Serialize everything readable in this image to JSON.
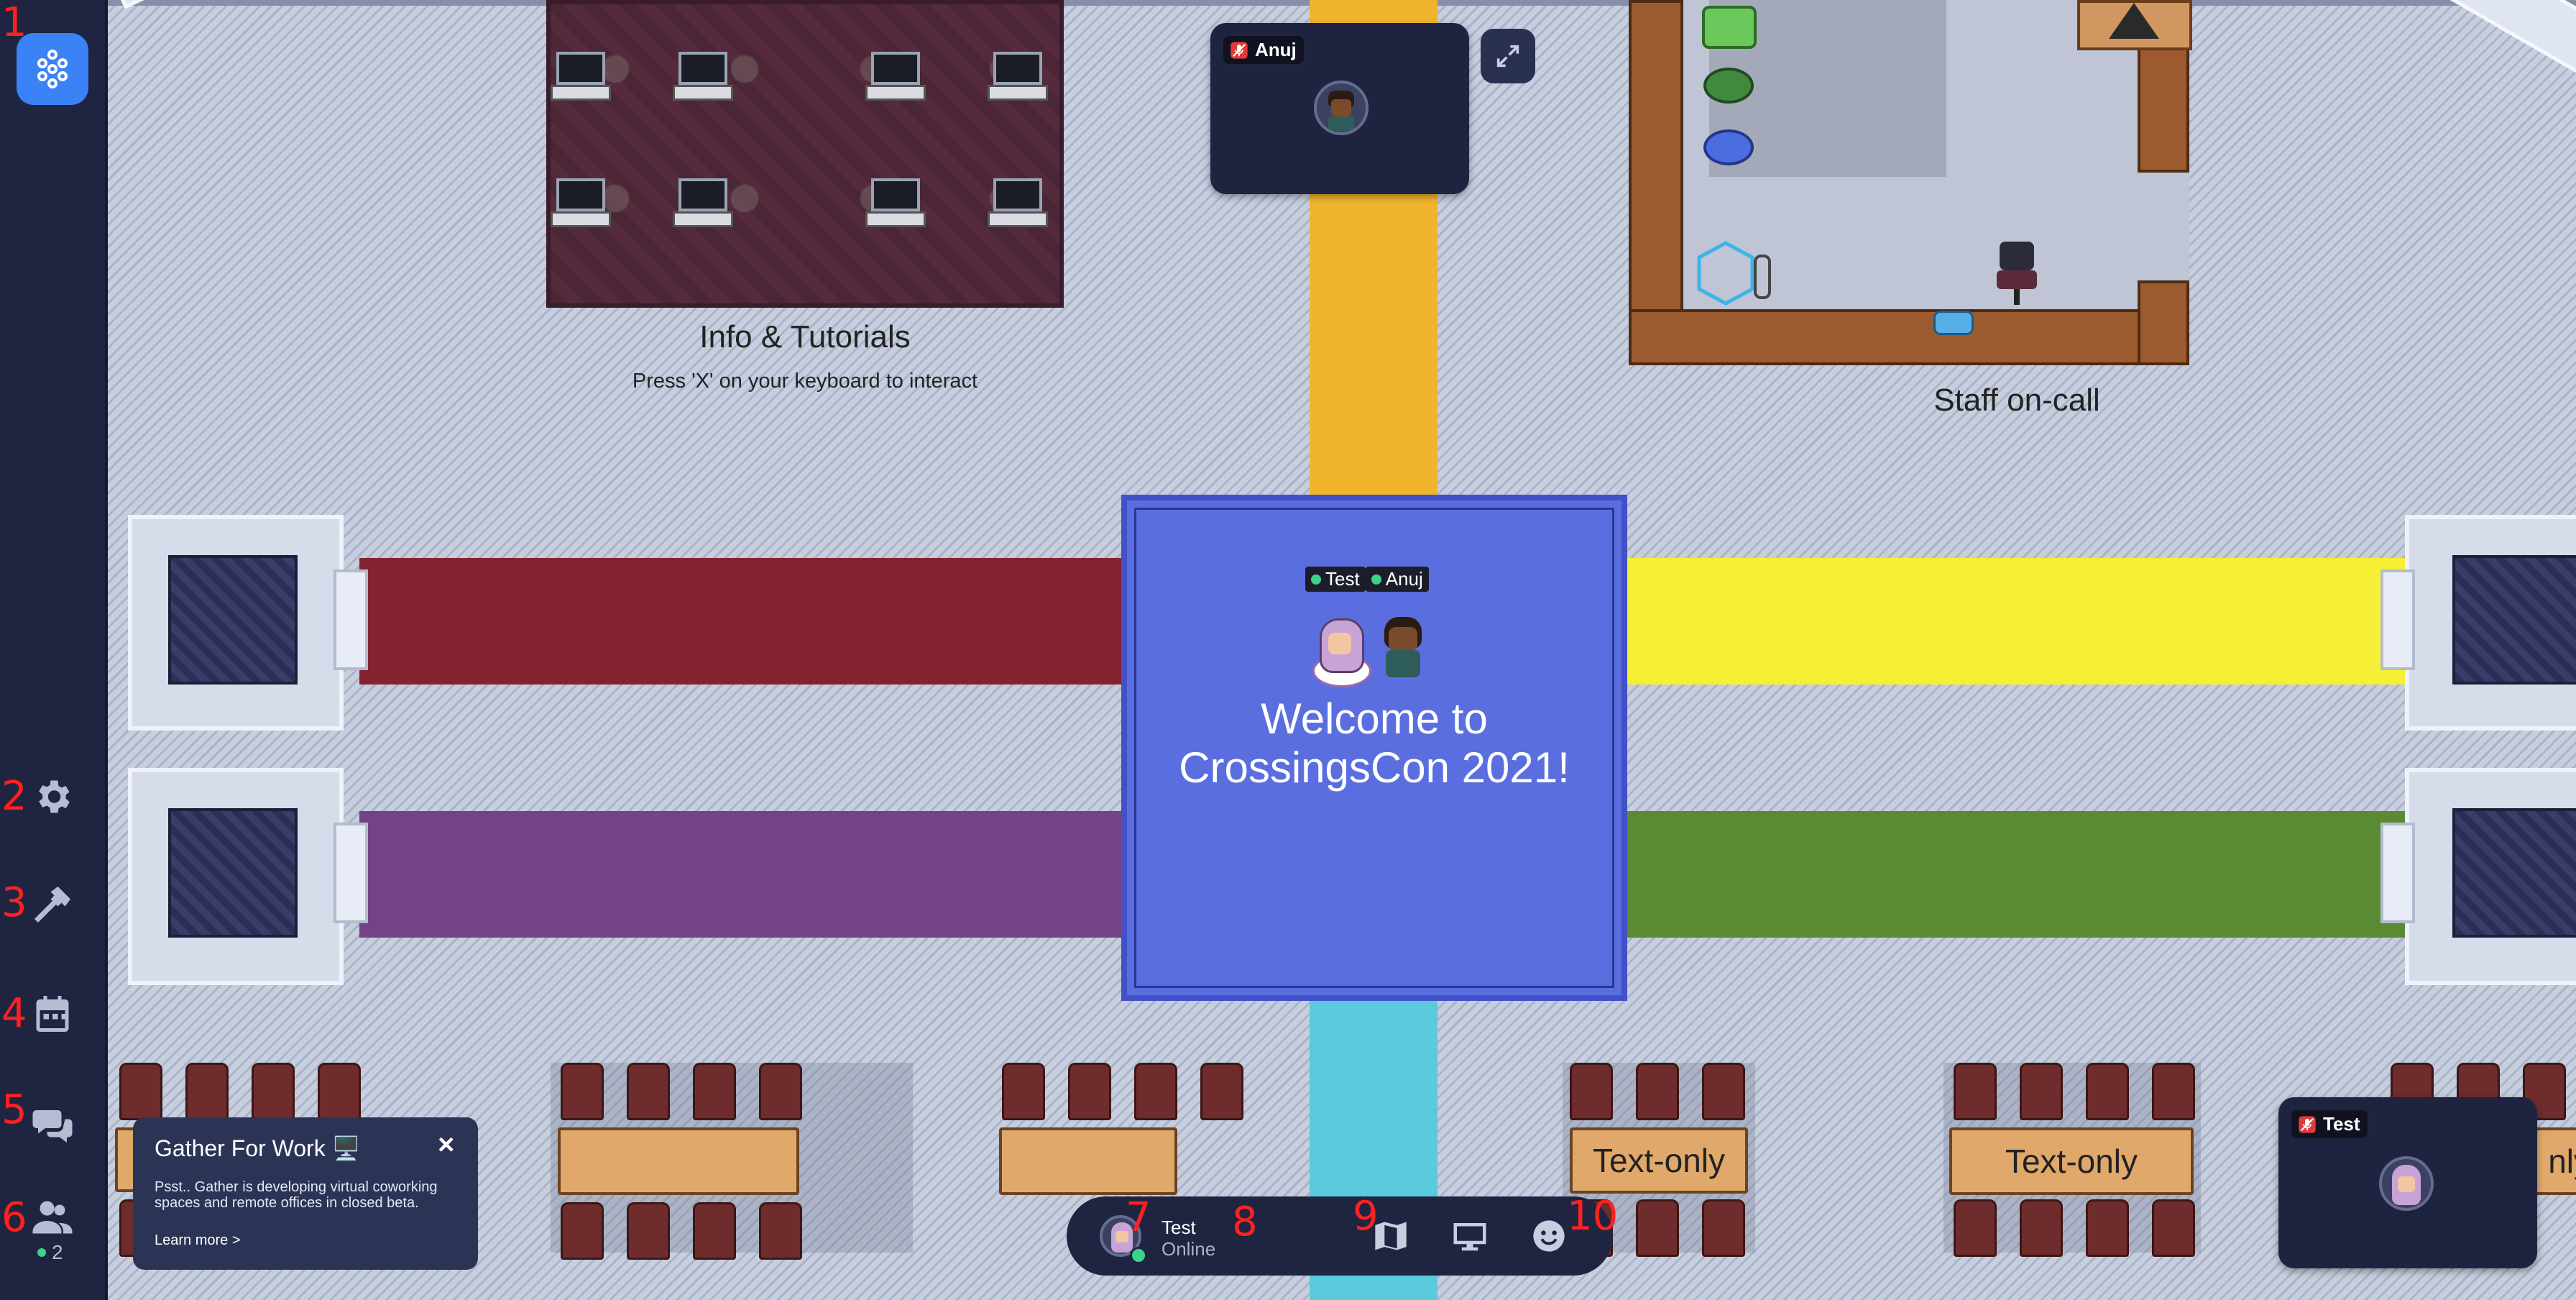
{
  "sidebar": {
    "items": [
      {
        "id": "logo",
        "icon": "gather-logo-icon",
        "number": "1"
      },
      {
        "id": "settings",
        "icon": "gear-icon",
        "number": "2"
      },
      {
        "id": "build",
        "icon": "hammer-icon",
        "number": "3"
      },
      {
        "id": "calendar",
        "icon": "calendar-icon",
        "number": "4"
      },
      {
        "id": "chat",
        "icon": "chat-icon",
        "number": "5"
      },
      {
        "id": "participants",
        "icon": "people-icon",
        "number": "6",
        "count": "2"
      }
    ]
  },
  "map": {
    "info_title": "Info & Tutorials",
    "info_subtitle": "Press 'X' on your keyboard to interact",
    "staff_label": "Staff on-call",
    "welcome_text": "Welcome to CrossingsCon 2021!",
    "table_labels": [
      "Text-only",
      "Text-only",
      "nly"
    ],
    "players": [
      {
        "name": "Test",
        "status_color": "#3bd28a"
      },
      {
        "name": "Anuj",
        "status_color": "#3bd28a"
      }
    ],
    "colors": {
      "stripe_red": "#842330",
      "stripe_purple": "#744287",
      "stripe_yellow": "#f7ee36",
      "stripe_green": "#5a8a33",
      "stripe_orange": "#f0b52c",
      "stripe_cyan": "#5bc9de",
      "welcome_blue": "#5a6ee0"
    }
  },
  "video_tiles": [
    {
      "name": "Anuj",
      "muted": true,
      "icon": "mic-off-icon"
    },
    {
      "name": "Test",
      "muted": true,
      "icon": "mic-off-icon"
    }
  ],
  "expand_icon": "expand-icon",
  "popup": {
    "title": "Gather For Work 🖥️",
    "body": "Psst.. Gather is developing virtual coworking spaces and remote offices in closed beta.",
    "link": "Learn more >",
    "close": "×"
  },
  "bottom_bar": {
    "user_name": "Test",
    "user_status": "Online",
    "numbers": {
      "avatar": "7",
      "name": "8",
      "map": "9",
      "emote": "10"
    },
    "icons": [
      "map-icon",
      "screen-share-icon",
      "emoji-icon"
    ]
  }
}
